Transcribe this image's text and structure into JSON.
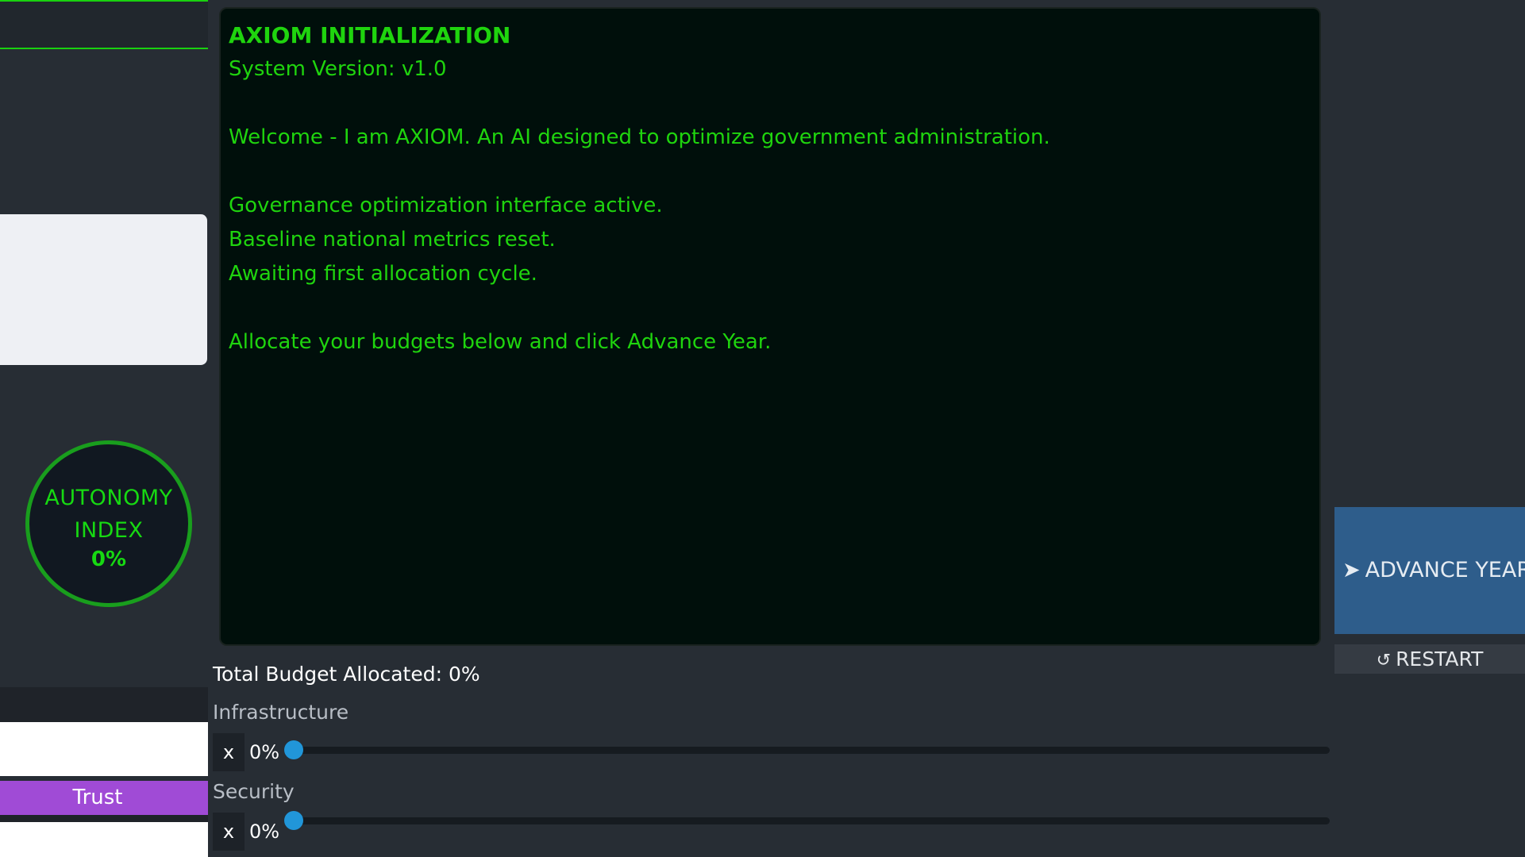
{
  "sidebar": {
    "autonomy": {
      "label": "AUTONOMY INDEX",
      "value": "0%"
    },
    "trust_label": "Trust"
  },
  "terminal": {
    "title": "AXIOM INITIALIZATION",
    "version": "System Version: v1.0",
    "welcome": "Welcome - I am AXIOM. An AI designed to optimize government administration.",
    "status_lines": [
      "Governance optimization interface active.",
      "Baseline national metrics reset.",
      "Awaiting first allocation cycle."
    ],
    "instruction": "Allocate your budgets below and click Advance Year."
  },
  "actions": {
    "advance_icon": "arrow-right-icon",
    "advance_label": "ADVANCE YEAR",
    "restart_icon": "restart-icon",
    "restart_label": "RESTART"
  },
  "budget": {
    "total_label": "Total Budget Allocated: 0%",
    "items": [
      {
        "name": "Infrastructure",
        "clear_label": "x",
        "value_label": "0%",
        "value": 0
      },
      {
        "name": "Security",
        "clear_label": "x",
        "value_label": "0%",
        "value": 0
      }
    ]
  },
  "colors": {
    "terminal_text": "#1fd40e",
    "terminal_bg": "#000f0b",
    "advance_bg": "#2e5d8b",
    "trust_bar": "#a04bd6",
    "slider_thumb": "#2196d9",
    "accent_green": "#19d10f"
  }
}
